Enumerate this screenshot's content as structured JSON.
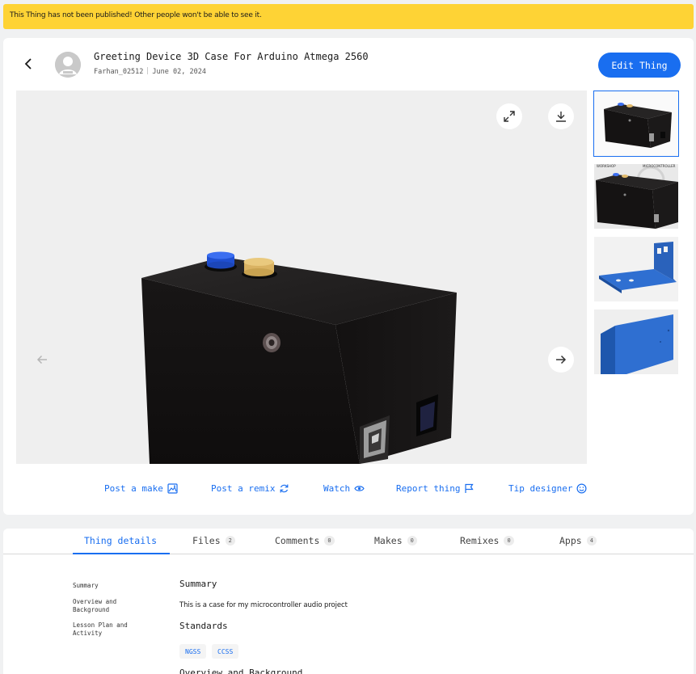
{
  "banner": {
    "text": "This Thing has not been published! Other people won't be able to see it."
  },
  "header": {
    "title": "Greeting Device 3D Case For Arduino Atmega 2560",
    "author": "Farhan_02512",
    "date": "June 02, 2024",
    "edit_label": "Edit Thing"
  },
  "viewer": {
    "expand_icon": "expand-icon",
    "download_icon": "download-icon",
    "prev_icon": "arrow-left-icon",
    "next_icon": "arrow-right-icon"
  },
  "thumbnails": [
    {
      "name": "black-case-front",
      "active": true
    },
    {
      "name": "black-case-workshop",
      "active": false,
      "caption_left": "WORKSHOP",
      "caption_right": "MICROCONTROLLER"
    },
    {
      "name": "blue-panel-top",
      "active": false
    },
    {
      "name": "blue-panel-side",
      "active": false
    }
  ],
  "actions": [
    {
      "label": "Post a make",
      "icon": "image-icon"
    },
    {
      "label": "Post a remix",
      "icon": "refresh-icon"
    },
    {
      "label": "Watch",
      "icon": "eye-icon"
    },
    {
      "label": "Report thing",
      "icon": "flag-icon"
    },
    {
      "label": "Tip designer",
      "icon": "smile-icon"
    }
  ],
  "tabs": [
    {
      "label": "Thing details",
      "count": null,
      "active": true
    },
    {
      "label": "Files",
      "count": "2"
    },
    {
      "label": "Comments",
      "count": "0"
    },
    {
      "label": "Makes",
      "count": "0"
    },
    {
      "label": "Remixes",
      "count": "0"
    },
    {
      "label": "Apps",
      "count": "4"
    }
  ],
  "toc": {
    "summary": "Summary",
    "overview_1": "Overview and",
    "overview_2": "Background",
    "lesson_1": "Lesson Plan and",
    "lesson_2": "Activity"
  },
  "details": {
    "summary_heading": "Summary",
    "summary_text": "This is a case for my microcontroller audio project",
    "standards_heading": "Standards",
    "standards": [
      "NGSS",
      "CCSS"
    ],
    "overview_heading": "Overview and Background"
  },
  "colors": {
    "accent": "#196ef0",
    "banner": "#fed335"
  }
}
